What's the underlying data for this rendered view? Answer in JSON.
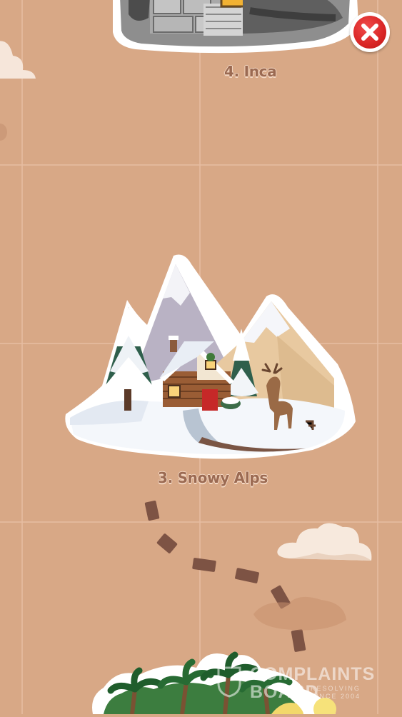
{
  "levels": [
    {
      "number_label": "4. Inca",
      "state": "locked"
    },
    {
      "number_label": "3. Snowy Alps",
      "state": "unlocked"
    }
  ],
  "close_button": {
    "icon": "close-icon",
    "color": "#d92525"
  },
  "watermark": {
    "line1": "COMPLAINTS",
    "line2": "BOARD",
    "tagline1": "RESOLVING",
    "tagline2": "SINCE 2004"
  },
  "colors": {
    "background": "#d8a886",
    "grid": "#e7bea1",
    "path": "#7d5344",
    "label": "#9b6a52"
  }
}
